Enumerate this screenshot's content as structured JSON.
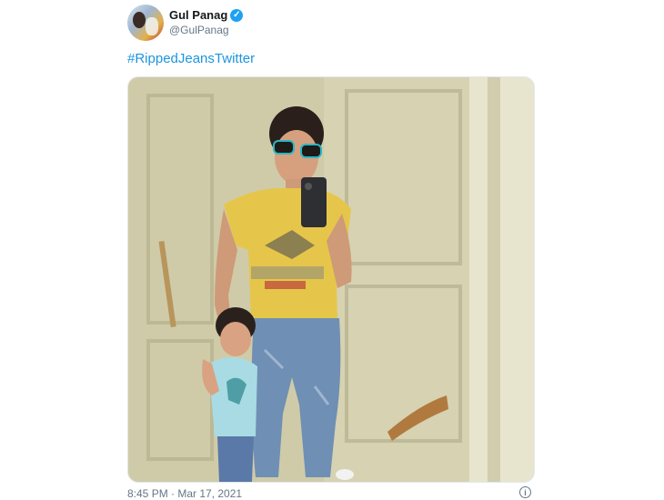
{
  "tweet": {
    "display_name": "Gul Panag",
    "handle": "@GulPanag",
    "text": "#RippedJeansTwitter",
    "timestamp": "8:45 PM · Mar 17, 2021",
    "verified": true
  },
  "icons": {
    "verified": "verified-badge-icon",
    "info": "info-icon"
  },
  "colors": {
    "link": "#1b95e0",
    "verified": "#1da1f2",
    "muted": "#657786"
  }
}
